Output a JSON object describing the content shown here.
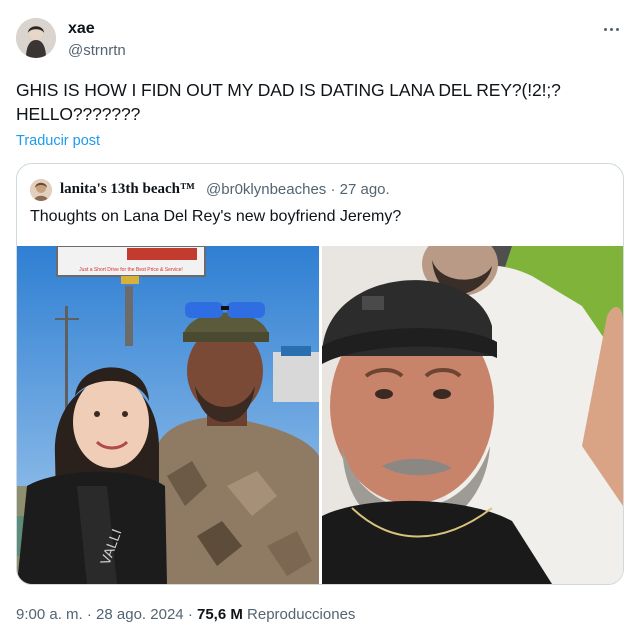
{
  "author": {
    "display_name": "xae",
    "handle": "@strnrtn"
  },
  "post": {
    "text": "GHIS IS HOW I FIDN OUT MY DAD IS DATING LANA DEL REY?(!2!;? HELLO???????",
    "translate_label": "Traducir post"
  },
  "quoted": {
    "display_name": "lanita's 13th beach™",
    "handle": "@br0klynbeaches",
    "separator": "·",
    "date": "27 ago.",
    "text": "Thoughts on Lana Del Rey's new boyfriend Jeremy?",
    "media_text": {
      "sign_line": "Just a Short Drive for the Best Price & Service!",
      "shirt_text": "VALLI"
    }
  },
  "meta": {
    "time": "9:00 a. m.",
    "separator": "·",
    "date": "28 ago. 2024",
    "views_count": "75,6 M",
    "views_label": "Reproducciones"
  },
  "colors": {
    "link": "#1d9bf0",
    "secondary_text": "#536471",
    "border": "#cfd9de"
  },
  "icons": {
    "more": "more-horizontal-icon"
  }
}
